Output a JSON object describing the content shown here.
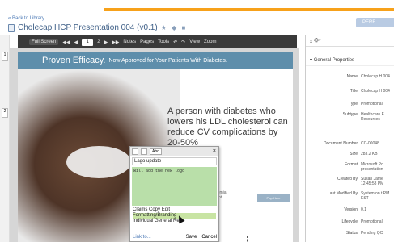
{
  "header": {
    "back_link": "« Back to Library",
    "title": "Cholecap HCP Presentation 004 (v0.1)",
    "title_icons": "★ ◆ ■",
    "right_tab": "PERE"
  },
  "toolbar": {
    "fullscreen": "Full Screen",
    "page": "1",
    "page_total": "2",
    "notes": "Notes",
    "pages": "Pages",
    "tools": "Tools",
    "view": "View",
    "zoom": "Zoom"
  },
  "slide": {
    "banner_big": "Proven Efficacy.",
    "banner_small": "Now Approved for Your Patients With Diabetes.",
    "headline": "A person with diabetes who lowers his LDL cholesterol can reduce CV complications by 20-50%",
    "partial_text_1": "pidemia",
    "partial_text_2": "atient",
    "cta": "Pop Here"
  },
  "note": {
    "abc": "Abc",
    "title": "Lago update",
    "body": "Will add the new logo",
    "categories": [
      "Claims",
      "Copy Edit",
      "Formatting/Branding",
      "Individual General Re"
    ],
    "link": "Link to...",
    "save": "Save",
    "cancel": "Cancel"
  },
  "panel": {
    "section": "General Properties",
    "properties": [
      {
        "key": "Name",
        "value": "Cholecap H 004"
      },
      {
        "key": "Title",
        "value": "Cholecap H 004"
      },
      {
        "key": "Type",
        "value": "Promotional"
      },
      {
        "key": "Subtype",
        "value": "Healthcare F Resources"
      },
      {
        "key": "Document Number",
        "value": "CC-00048"
      },
      {
        "key": "Size",
        "value": "283.2 KB"
      },
      {
        "key": "Format",
        "value": "Microsoft Po presentation"
      },
      {
        "key": "Created By",
        "value": "Susan Jame 12:45:58 PM"
      },
      {
        "key": "Last Modified By",
        "value": "System on t PM EST"
      },
      {
        "key": "Version",
        "value": "0.1"
      },
      {
        "key": "Lifecycle",
        "value": "Promotional"
      },
      {
        "key": "Status",
        "value": "Pending QC"
      }
    ]
  }
}
